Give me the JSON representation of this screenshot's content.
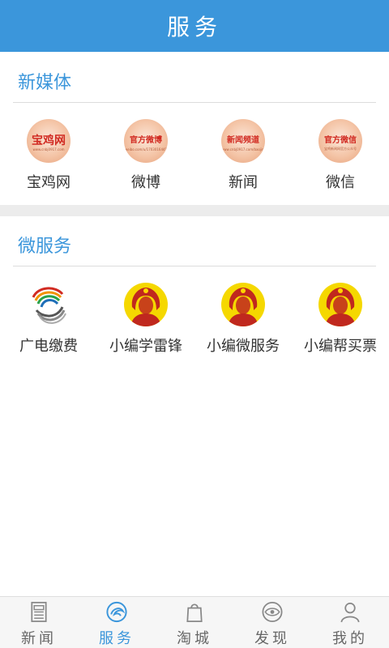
{
  "header": {
    "title": "服务"
  },
  "sections": [
    {
      "title": "新媒体",
      "items": [
        {
          "label": "宝鸡网",
          "icon": "baojiwang-logo-icon",
          "badge": "宝鸡网",
          "sub": "www.cnbj0917.com"
        },
        {
          "label": "微博",
          "icon": "official-weibo-icon",
          "badge": "官方微博",
          "sub": "weibo.com/u/1703016441"
        },
        {
          "label": "新闻",
          "icon": "news-channel-icon",
          "badge": "新闻频道",
          "sub": "www.cnbj0917.com/baojinews"
        },
        {
          "label": "微信",
          "icon": "official-wechat-icon",
          "badge": "官方微信",
          "sub": "宝鸡新闻网官方公众号"
        }
      ]
    },
    {
      "title": "微服务",
      "items": [
        {
          "label": "广电缴费",
          "icon": "broadcast-tv-logo-icon"
        },
        {
          "label": "小编学雷锋",
          "icon": "lei-feng-portrait-icon"
        },
        {
          "label": "小编微服务",
          "icon": "lei-feng-portrait-icon"
        },
        {
          "label": "小编帮买票",
          "icon": "lei-feng-portrait-icon"
        }
      ]
    }
  ],
  "tabbar": {
    "tabs": [
      {
        "label": "新闻",
        "icon": "newspaper-icon",
        "active": false
      },
      {
        "label": "服务",
        "icon": "service-swirl-icon",
        "active": true
      },
      {
        "label": "淘城",
        "icon": "shopping-bag-icon",
        "active": false
      },
      {
        "label": "发现",
        "icon": "eye-icon",
        "active": false
      },
      {
        "label": "我的",
        "icon": "person-icon",
        "active": false
      }
    ]
  },
  "colors": {
    "brand": "#3b96db",
    "badge_red": "#d12b22",
    "leifeng_yellow": "#f5d800"
  }
}
